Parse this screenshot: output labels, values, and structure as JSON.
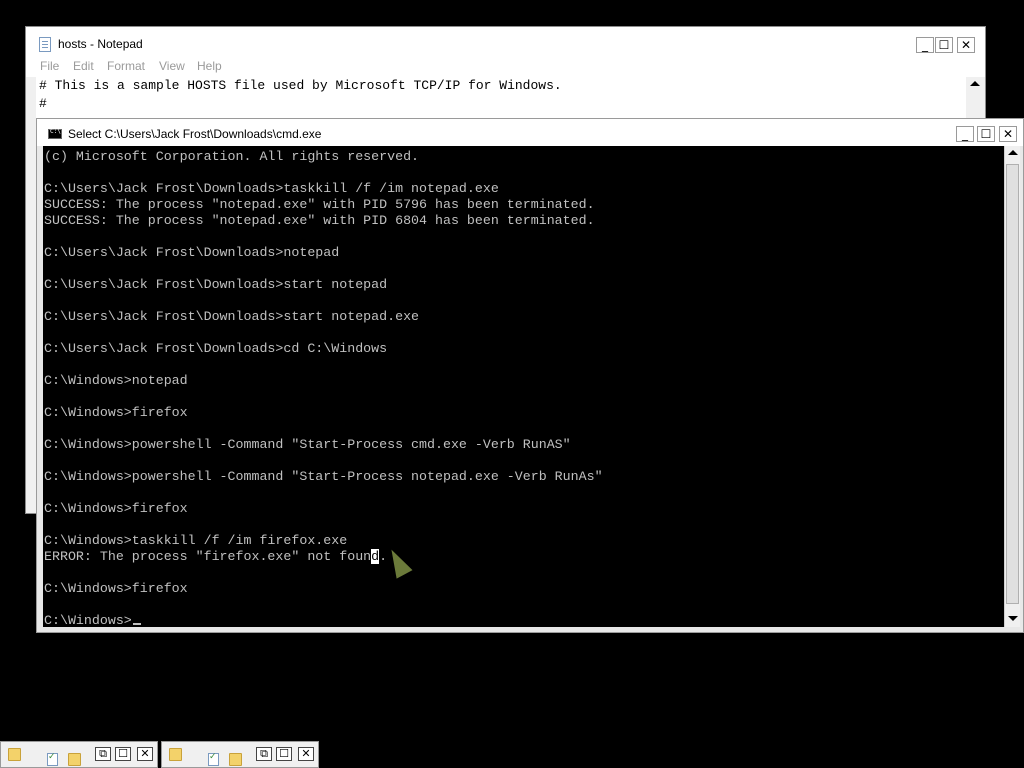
{
  "notepad": {
    "title": "hosts - Notepad",
    "menu": [
      "File",
      "Edit",
      "Format",
      "View",
      "Help"
    ],
    "lines": [
      "# This is a sample HOSTS file used by Microsoft TCP/IP for Windows.",
      "#"
    ],
    "buttons": {
      "minimize": "_",
      "maximize": "☐",
      "close": "✕"
    }
  },
  "cmd": {
    "title": "Select C:\\Users\\Jack Frost\\Downloads\\cmd.exe",
    "buttons": {
      "minimize": "_",
      "maximize": "☐",
      "close": "✕"
    },
    "lines": [
      "(c) Microsoft Corporation. All rights reserved.",
      "",
      "C:\\Users\\Jack Frost\\Downloads>taskkill /f /im notepad.exe",
      "SUCCESS: The process \"notepad.exe\" with PID 5796 has been terminated.",
      "SUCCESS: The process \"notepad.exe\" with PID 6804 has been terminated.",
      "",
      "C:\\Users\\Jack Frost\\Downloads>notepad",
      "",
      "C:\\Users\\Jack Frost\\Downloads>start notepad",
      "",
      "C:\\Users\\Jack Frost\\Downloads>start notepad.exe",
      "",
      "C:\\Users\\Jack Frost\\Downloads>cd C:\\Windows",
      "",
      "C:\\Windows>notepad",
      "",
      "C:\\Windows>firefox",
      "",
      "C:\\Windows>powershell -Command \"Start-Process cmd.exe -Verb RunAS\"",
      "",
      "C:\\Windows>powershell -Command \"Start-Process notepad.exe -Verb RunAs\"",
      "",
      "C:\\Windows>firefox",
      "",
      "C:\\Windows>taskkill /f /im firefox.exe"
    ],
    "error_line": {
      "before": "ERROR: The process \"firefox.exe\" not foun",
      "selected": "d",
      "after": "."
    },
    "trailing_lines": [
      "",
      "C:\\Windows>firefox",
      ""
    ],
    "prompt": "C:\\Windows>"
  },
  "minimized": [
    {
      "buttons": {
        "restore": "⧉",
        "maximize": "☐",
        "close": "✕"
      }
    },
    {
      "buttons": {
        "restore": "⧉",
        "maximize": "☐",
        "close": "✕"
      }
    }
  ]
}
